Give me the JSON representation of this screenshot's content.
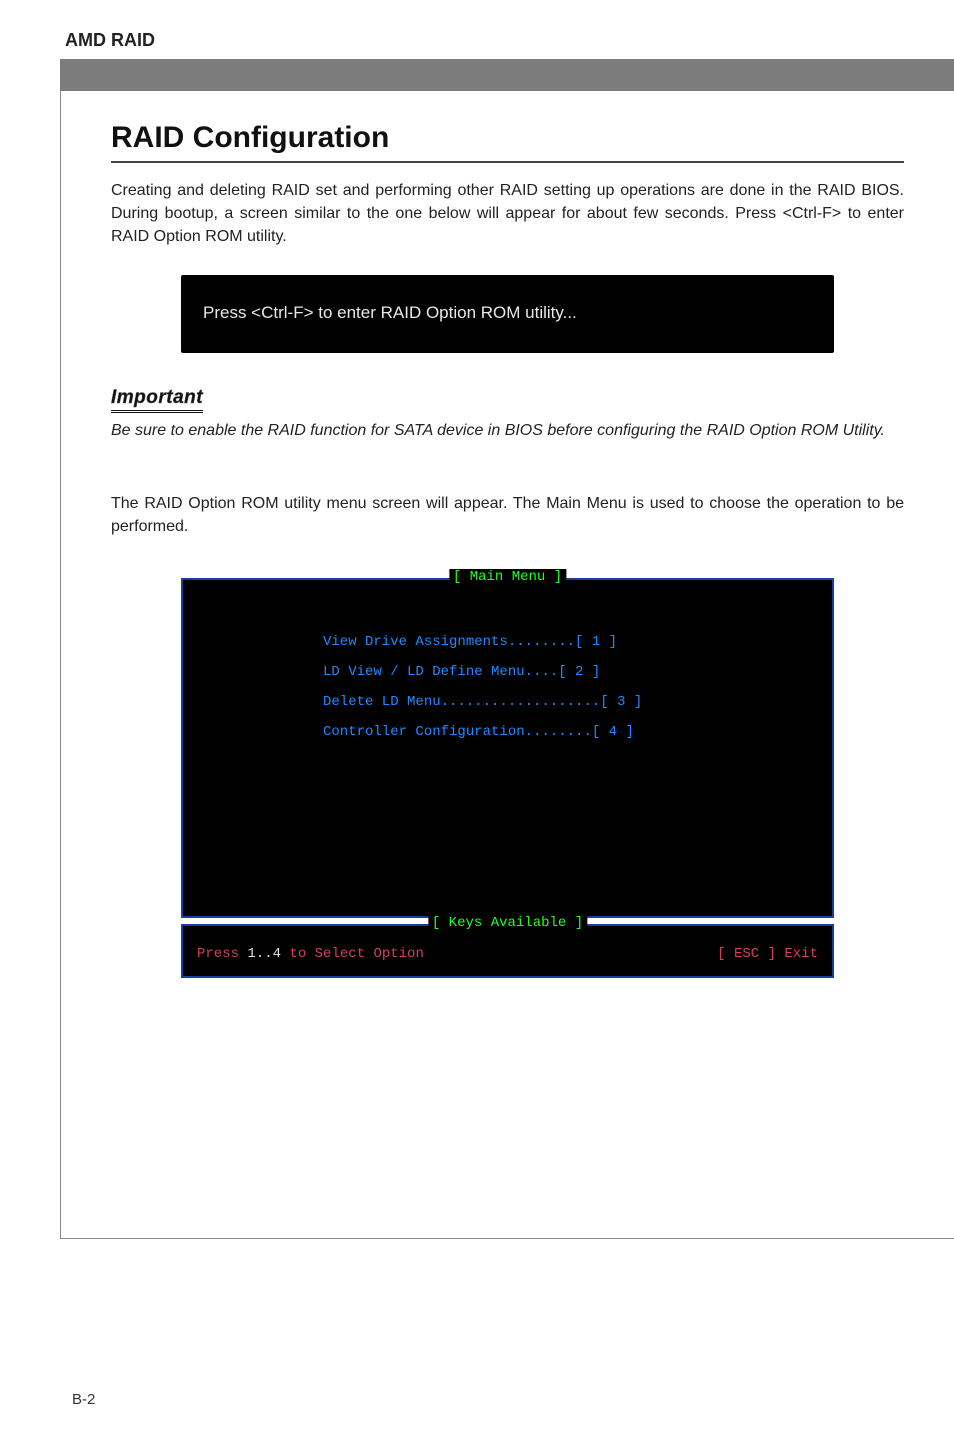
{
  "header": {
    "title": "AMD RAID"
  },
  "section": {
    "title": "RAID Configuration",
    "para1": "Creating and deleting RAID set and performing other RAID setting up operations are done in the RAID BIOS. During bootup, a screen similar to the one below will appear for about few seconds. Press <Ctrl-F> to enter RAID Option ROM utility.",
    "prompt": "Press <Ctrl-F> to enter RAID Option ROM utility...",
    "important_label": "Important",
    "important_text": "Be sure to enable the RAID function for SATA device in BIOS before configuring the RAID Option ROM Utility.",
    "para2": "The RAID Option ROM utility menu screen will appear. The Main Menu is used to choose the operation to be performed."
  },
  "bios": {
    "main_title": "[ Main Menu ]",
    "items": [
      "View Drive Assignments........[  1  ]",
      "LD View / LD Define Menu....[  2  ]",
      "Delete LD Menu...................[  3  ]",
      "Controller Configuration........[  4  ]"
    ],
    "keys_title": "[ Keys Available ]",
    "keys_left_prefix": "Press ",
    "keys_left_range": "1..4",
    "keys_left_suffix": " to Select Option",
    "keys_right": "[ ESC ]  Exit"
  },
  "footer": {
    "page": "B-2"
  }
}
